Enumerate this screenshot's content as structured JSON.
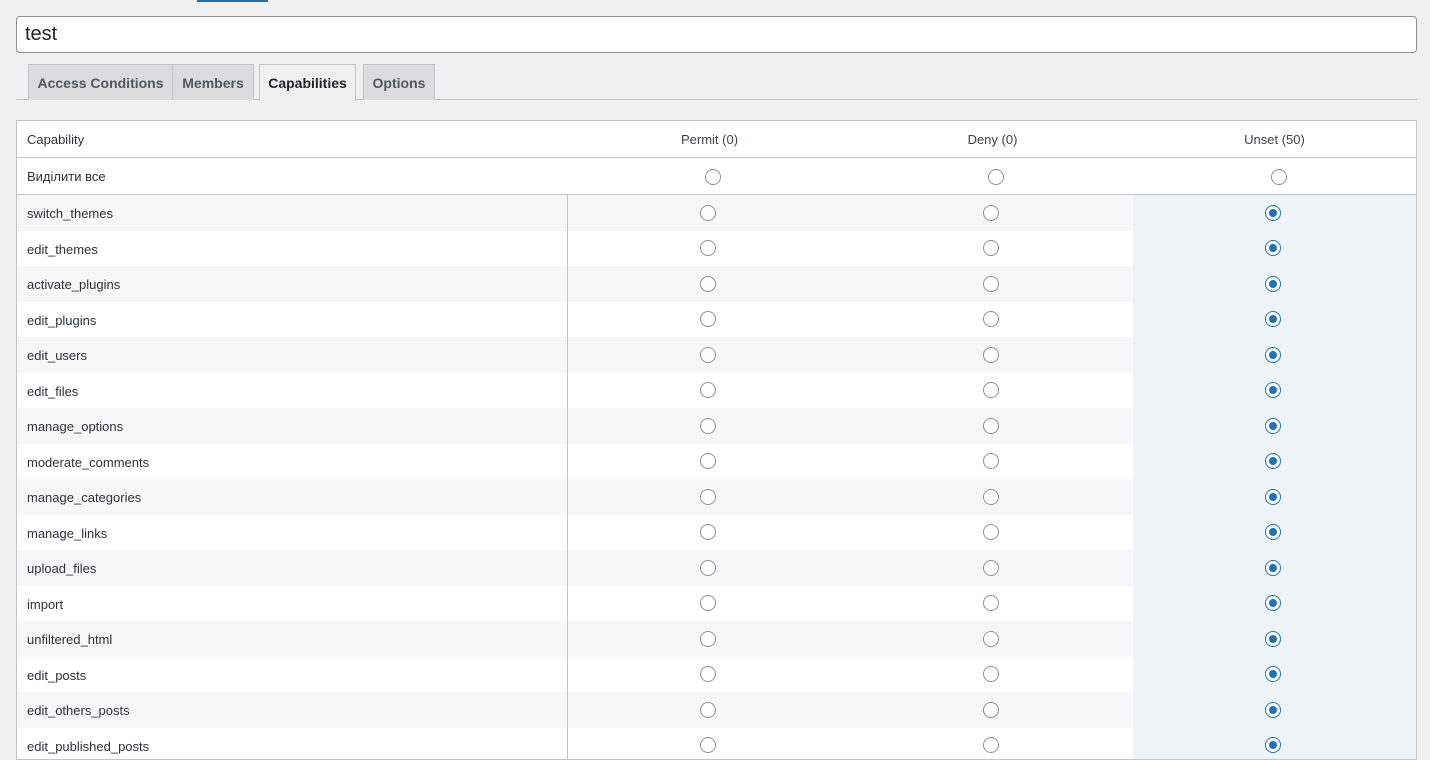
{
  "form": {
    "title_value": "test"
  },
  "tabs": [
    {
      "label": "Access Conditions",
      "active": false
    },
    {
      "label": "Members",
      "active": false
    },
    {
      "label": "Capabilities",
      "active": true
    },
    {
      "label": "Options",
      "active": false
    }
  ],
  "table": {
    "headers": {
      "capability": "Capability",
      "permit": "Permit (0)",
      "deny": "Deny (0)",
      "unset": "Unset (50)"
    },
    "select_all_label": "Виділити все",
    "rows": [
      {
        "name": "switch_themes",
        "state": "unset"
      },
      {
        "name": "edit_themes",
        "state": "unset"
      },
      {
        "name": "activate_plugins",
        "state": "unset"
      },
      {
        "name": "edit_plugins",
        "state": "unset"
      },
      {
        "name": "edit_users",
        "state": "unset"
      },
      {
        "name": "edit_files",
        "state": "unset"
      },
      {
        "name": "manage_options",
        "state": "unset"
      },
      {
        "name": "moderate_comments",
        "state": "unset"
      },
      {
        "name": "manage_categories",
        "state": "unset"
      },
      {
        "name": "manage_links",
        "state": "unset"
      },
      {
        "name": "upload_files",
        "state": "unset"
      },
      {
        "name": "import",
        "state": "unset"
      },
      {
        "name": "unfiltered_html",
        "state": "unset"
      },
      {
        "name": "edit_posts",
        "state": "unset"
      },
      {
        "name": "edit_others_posts",
        "state": "unset"
      },
      {
        "name": "edit_published_posts",
        "state": "unset"
      }
    ]
  },
  "colors": {
    "accent": "#2271b1",
    "unset_column_bg": "#edf3f7"
  }
}
